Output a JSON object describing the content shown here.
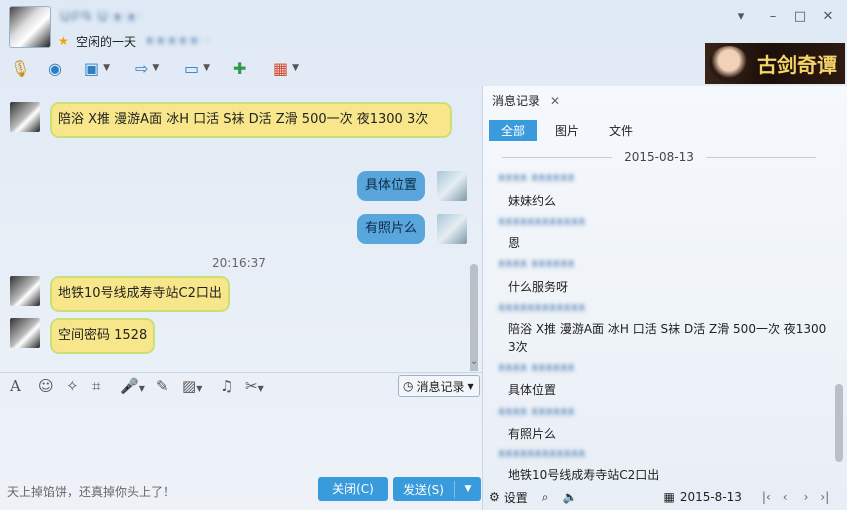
{
  "window": {
    "contact_name": "ԱԲԳ Ա·ᴥ·ᴥ·",
    "signature": "空闲的一天",
    "signature_extra": "ᴥ·ᴥ·ᴥ·ᴥ·ᴥ· ·"
  },
  "banner": {
    "text": "古剑奇谭"
  },
  "chat": {
    "messages": [
      {
        "dir": "in",
        "text": "陪浴 X推 漫游A面 冰H 口活 S袜  D活  Z滑  500一次  夜1300 3次"
      },
      {
        "dir": "out",
        "text": "具体位置"
      },
      {
        "dir": "out",
        "text": "有照片么"
      },
      {
        "dir": "in",
        "text": "地铁10号线成寿寺站C2口出"
      },
      {
        "dir": "in",
        "text": "空间密码  1528"
      }
    ],
    "timestamp": "20:16:37"
  },
  "input": {
    "history_button": "消息记录",
    "hint": "天上掉馅饼，还真掉你头上了！",
    "close_label": "关闭(C)",
    "send_label": "发送(S)"
  },
  "history": {
    "tab_label": "消息记录",
    "filters": [
      "全部",
      "图片",
      "文件"
    ],
    "date": "2015-08-13",
    "entries": [
      {
        "meta": "ᴥᴥᴥᴥ ᴥᴥᴥᴥᴥᴥ",
        "text": "妹妹约么"
      },
      {
        "meta": "ᴥᴥᴥᴥᴥᴥᴥᴥᴥᴥᴥᴥ",
        "text": "恩"
      },
      {
        "meta": "ᴥᴥᴥᴥ ᴥᴥᴥᴥᴥᴥ",
        "text": "什么服务呀"
      },
      {
        "meta": "ᴥᴥᴥᴥᴥᴥᴥᴥᴥᴥᴥᴥ",
        "text": "   陪浴 X推 漫游A面 冰H 口活 S袜  D活  Z滑  500一次  夜1300 3次"
      },
      {
        "meta": "ᴥᴥᴥᴥ ᴥᴥᴥᴥᴥᴥ",
        "text": "具体位置"
      },
      {
        "meta": "ᴥᴥᴥᴥ ᴥᴥᴥᴥᴥᴥ",
        "text": "有照片么"
      },
      {
        "meta": "ᴥᴥᴥᴥᴥᴥᴥᴥᴥᴥᴥᴥ",
        "text": "地铁10号线成寿寺站C2口出"
      }
    ],
    "settings_label": "设置",
    "footer_date": "2015-8-13"
  }
}
